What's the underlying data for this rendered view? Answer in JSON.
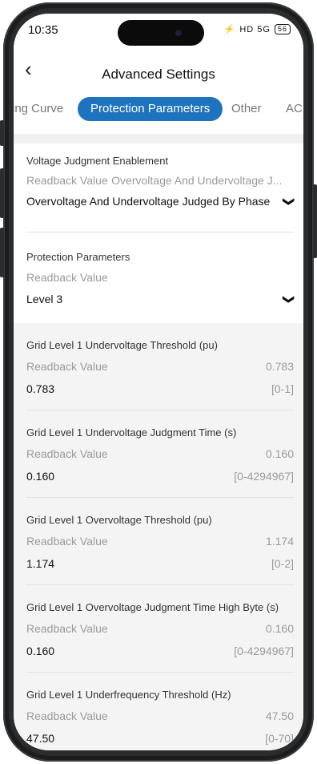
{
  "status": {
    "time": "10:35",
    "icons": "HD 5G",
    "battery": "56"
  },
  "header": {
    "back_icon": "chevron-left-icon",
    "back_glyph": "‹",
    "title": "Advanced Settings"
  },
  "tabs": [
    {
      "label": "ing Curve"
    },
    {
      "label": "Protection Parameters",
      "active": true
    },
    {
      "label": "Other"
    },
    {
      "label": "AC C"
    }
  ],
  "colors": {
    "accent": "#1e73be"
  },
  "voltage_judgment": {
    "label": "Voltage Judgment Enablement",
    "readback_label": "Readback Value",
    "readback_value": "Overvoltage And Undervoltage J...",
    "selected": "Overvoltage And Undervoltage Judged By Phase",
    "chevron": "❯"
  },
  "protection_parameters": {
    "label": "Protection Parameters",
    "readback_label": "Readback Value",
    "selected": "Level 3",
    "chevron": "❯"
  },
  "params": [
    {
      "label": "Grid Level 1 Undervoltage Threshold (pu)",
      "readback_label": "Readback Value",
      "readback_value": "0.783",
      "value": "0.783",
      "range": "[0-1]"
    },
    {
      "label": "Grid Level 1 Undervoltage Judgment Time (s)",
      "readback_label": "Readback Value",
      "readback_value": "0.160",
      "value": "0.160",
      "range": "[0-4294967]"
    },
    {
      "label": "Grid Level 1 Overvoltage Threshold (pu)",
      "readback_label": "Readback Value",
      "readback_value": "1.174",
      "value": "1.174",
      "range": "[0-2]"
    },
    {
      "label": "Grid Level 1 Overvoltage Judgment Time High Byte (s)",
      "readback_label": "Readback Value",
      "readback_value": "0.160",
      "value": "0.160",
      "range": "[0-4294967]"
    },
    {
      "label": "Grid Level 1 Underfrequency Threshold (Hz)",
      "readback_label": "Readback Value",
      "readback_value": "47.50",
      "value": "47.50",
      "range": "[0-70]"
    }
  ]
}
